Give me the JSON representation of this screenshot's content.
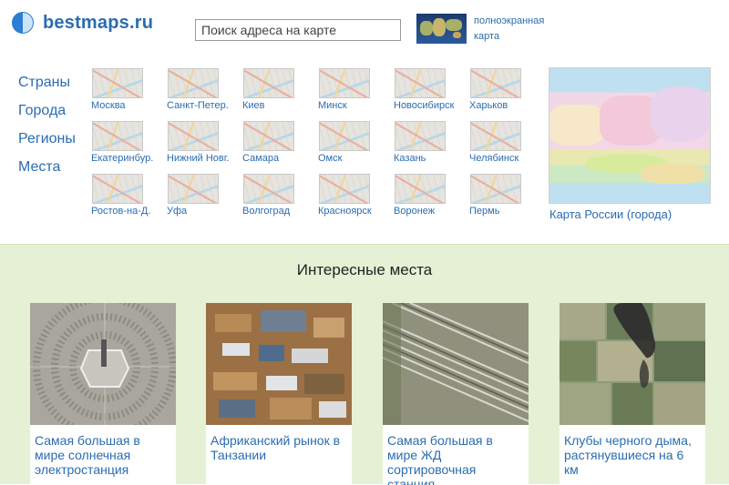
{
  "logo": {
    "text": "bestmaps.ru"
  },
  "search": {
    "placeholder": "Поиск адреса на карте"
  },
  "fullscreen": {
    "label": "полноэкранная карта"
  },
  "nav": [
    {
      "label": "Страны"
    },
    {
      "label": "Города"
    },
    {
      "label": "Регионы"
    },
    {
      "label": "Места"
    }
  ],
  "cities": [
    {
      "label": "Москва"
    },
    {
      "label": "Санкт-Петер."
    },
    {
      "label": "Киев"
    },
    {
      "label": "Минск"
    },
    {
      "label": "Новосибирск"
    },
    {
      "label": "Харьков"
    },
    {
      "label": "Екатеринбур."
    },
    {
      "label": "Нижний Новг."
    },
    {
      "label": "Самара"
    },
    {
      "label": "Омск"
    },
    {
      "label": "Казань"
    },
    {
      "label": "Челябинск"
    },
    {
      "label": "Ростов-на-Д."
    },
    {
      "label": "Уфа"
    },
    {
      "label": "Волгоград"
    },
    {
      "label": "Красноярск"
    },
    {
      "label": "Воронеж"
    },
    {
      "label": "Пермь"
    }
  ],
  "russia": {
    "caption": "Карта России (города)"
  },
  "places": {
    "title": "Интересные места",
    "cards": [
      {
        "caption": "Самая большая в мире солнечная электростанция"
      },
      {
        "caption": "Африканский рынок в Танзании"
      },
      {
        "caption": "Самая большая в мире ЖД сортировочная станция"
      },
      {
        "caption": "Клубы черного дыма, растянувшиеся на 6 км"
      }
    ]
  }
}
